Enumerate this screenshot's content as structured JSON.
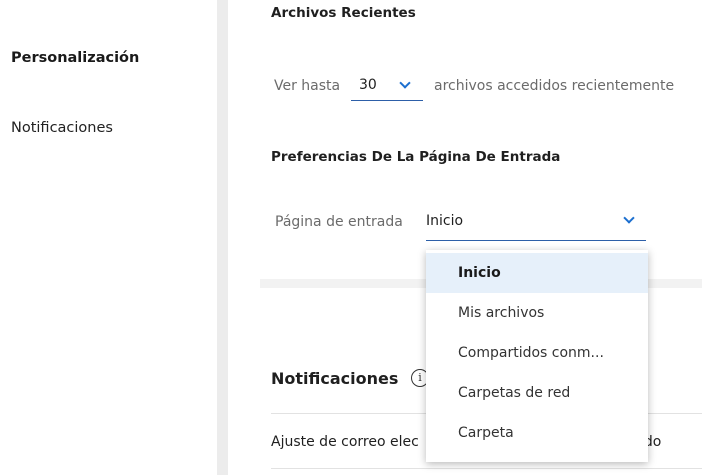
{
  "sidebar": {
    "items": [
      {
        "label": "Personalización",
        "active": true
      },
      {
        "label": "Notificaciones",
        "active": false
      }
    ]
  },
  "recent_files": {
    "title": "Archivos Recientes",
    "prefix": "Ver hasta",
    "count_value": "30",
    "suffix": "archivos accedidos recientemente"
  },
  "landing_prefs": {
    "title": "Preferencias De La Página De Entrada",
    "label": "Página de entrada",
    "selected_value": "Inicio",
    "options": [
      "Inicio",
      "Mis archivos",
      "Compartidos conm...",
      "Carpetas de red",
      "Carpeta"
    ]
  },
  "notifications": {
    "title": "Notificaciones",
    "info_icon": "info-icon",
    "row_left": "Ajuste de correo elec",
    "row_right": "ido"
  },
  "colors": {
    "accent": "#1c6fcf",
    "selected_bg": "#e6f0fa",
    "divider": "#ececec"
  }
}
